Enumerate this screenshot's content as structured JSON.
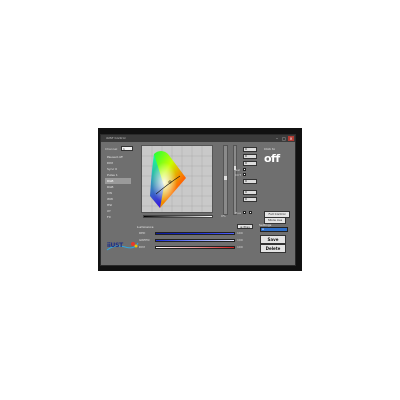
{
  "window": {
    "title": "iiUST Control"
  },
  "sidebar": {
    "channel_label": "Channel",
    "channel_value": "1",
    "items": [
      {
        "label": "Paused off"
      },
      {
        "label": "DIM"
      },
      {
        "label": "Sync 0"
      },
      {
        "label": "Pulse 1"
      },
      {
        "label": "RGB"
      },
      {
        "label": "RGB"
      },
      {
        "label": "CW"
      },
      {
        "label": "WW"
      },
      {
        "label": "HSI"
      },
      {
        "label": "XY"
      },
      {
        "label": "FX"
      }
    ],
    "selected_index": 4
  },
  "logo": {
    "text": "iiUST",
    "sub": ""
  },
  "onoff": {
    "label": "Click to",
    "value": "off"
  },
  "controls": {
    "fields": [
      "0",
      "0",
      "0",
      "0",
      "0",
      "0",
      "0"
    ],
    "check_labels": [
      "Gel",
      "CCT",
      "Hue"
    ],
    "grad_label": "0%"
  },
  "buttons": {
    "live_mode": "Full Control",
    "preview": "Store cue",
    "save": "Save",
    "delete": "Delete",
    "lum_btn": "≡ Prev"
  },
  "luminance": {
    "header": "Luminance",
    "rows": [
      {
        "label": "RED",
        "value": "100"
      },
      {
        "label": "GREEN",
        "value": "100"
      },
      {
        "label": "DIM",
        "value": "100"
      }
    ]
  },
  "saved": {
    "header": "Settings",
    "selected": "A"
  },
  "colors": {
    "window_bg": "#6f6f6f",
    "accent_blue": "#2e6ec7",
    "bar_blue": "#1a2fd6",
    "bar_red": "#d12020"
  }
}
